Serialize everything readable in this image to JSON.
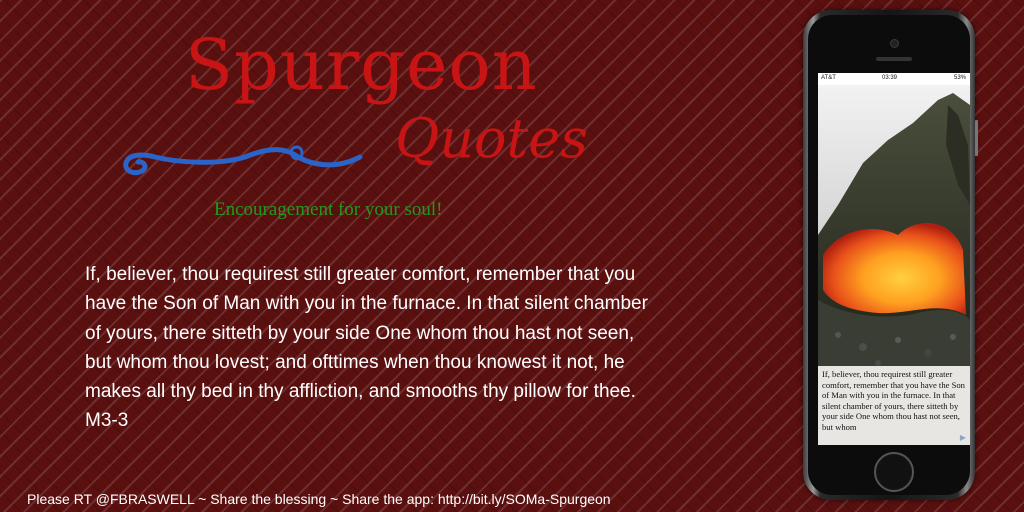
{
  "header": {
    "title": "Spurgeon",
    "subtitle": "Quotes",
    "tagline": "Encouragement for your soul!"
  },
  "quote": {
    "text": "If, believer, thou requirest still greater comfort, remember that you have the Son of Man with you in the furnace. In that silent chamber of yours, there sitteth by your side One whom thou hast not seen, but whom thou lovest; and ofttimes when thou knowest it not, he makes all thy bed in thy affliction, and smooths thy pillow for thee. M3-3"
  },
  "footer": {
    "text": "Please RT @FBRASWELL ~ Share the blessing ~ Share the app: http://bit.ly/SOMa-Spurgeon"
  },
  "phone": {
    "status": {
      "carrier": "AT&T",
      "time": "03:39",
      "battery": "53%"
    },
    "screen_text": "If, believer, thou requirest still greater comfort, remember that you have the Son of Man with you in the furnace. In that silent chamber of yours, there sitteth by your side One whom thou hast not seen, but whom"
  },
  "colors": {
    "background": "#5b1010",
    "title": "#c81414",
    "tagline": "#1e9b1e",
    "swash": "#2a64c8",
    "text": "#ffffff"
  },
  "icons": {
    "decoration": "swash-flourish-icon",
    "screen": "share-icon"
  }
}
